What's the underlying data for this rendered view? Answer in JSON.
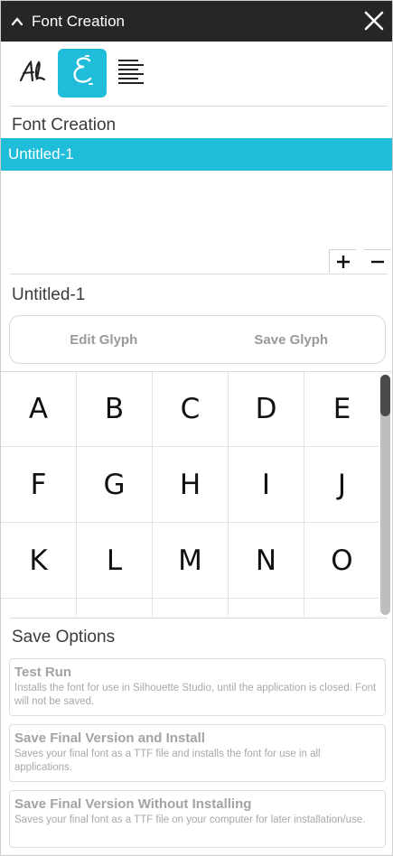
{
  "window": {
    "title": "Font Creation"
  },
  "tabs": [
    {
      "name": "font-styles",
      "icon": "script-font-icon",
      "active": false
    },
    {
      "name": "font-creation",
      "icon": "font-creation-icon",
      "active": true
    },
    {
      "name": "text-align",
      "icon": "align-lines-icon",
      "active": false
    }
  ],
  "font_list": {
    "heading": "Font Creation",
    "items": [
      "Untitled-1"
    ],
    "selected_index": 0,
    "add_label": "+",
    "remove_label": "−"
  },
  "current_font": {
    "name": "Untitled-1"
  },
  "glyph_actions": {
    "edit": "Edit Glyph",
    "save": "Save Glyph"
  },
  "glyphs": [
    "A",
    "B",
    "C",
    "D",
    "E",
    "F",
    "G",
    "H",
    "I",
    "J",
    "K",
    "L",
    "M",
    "N",
    "O",
    "",
    "",
    "",
    "",
    ""
  ],
  "save_options": {
    "heading": "Save Options",
    "options": [
      {
        "title": "Test Run",
        "description": "Installs the font for use in Silhouette Studio, until the application is closed. Font will not be saved."
      },
      {
        "title": "Save Final Version and Install",
        "description": "Saves your final font as a TTF file and installs the font for use in all applications."
      },
      {
        "title": "Save Final Version Without Installing",
        "description": "Saves your final font as a TTF file on your computer for later installation/use."
      }
    ]
  },
  "colors": {
    "accent": "#1fbdd9",
    "titlebar": "#262626"
  }
}
